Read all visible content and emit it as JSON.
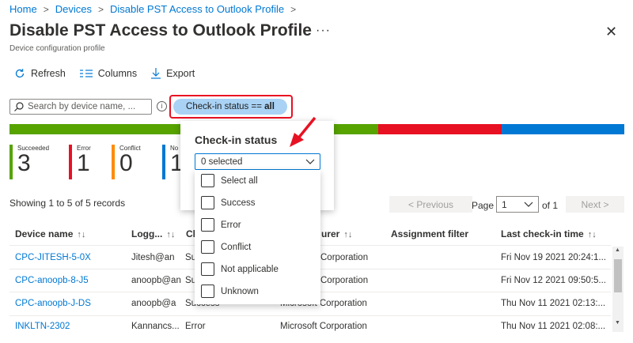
{
  "breadcrumb": [
    "Home",
    "Devices",
    "Disable PST Access to Outlook Profile"
  ],
  "title": "Disable PST Access to Outlook Profile",
  "title_menu": "···",
  "subtitle": "Device configuration profile",
  "toolbar": {
    "refresh": "Refresh",
    "columns": "Columns",
    "export": "Export"
  },
  "search": {
    "placeholder": "Search by device name, ...",
    "value": ""
  },
  "filter_pill": {
    "prefix": "Check-in status == ",
    "value": "all"
  },
  "status_bar_colors": {
    "succeeded": "#57a300",
    "error": "#e81123",
    "conflict": "#ff8c00",
    "not_applicable": "#0078d4"
  },
  "status_bar_shares": {
    "succeeded": 3,
    "error": 1,
    "conflict": 0,
    "not_applicable": 1
  },
  "counters": [
    {
      "label": "Succeeded",
      "value": "3",
      "color": "#57a300"
    },
    {
      "label": "Error",
      "value": "1",
      "color": "#e81123"
    },
    {
      "label": "Conflict",
      "value": "0",
      "color": "#ff8c00"
    },
    {
      "label": "No",
      "value": "1",
      "color": "#0078d4"
    }
  ],
  "showing_text": "Showing 1 to 5 of 5 records",
  "pager": {
    "prev": "< Previous",
    "page_label": "Page",
    "page_value": "1",
    "of_label": "of 1",
    "next": "Next >"
  },
  "table": {
    "headers": [
      "Device name",
      "Logg...",
      "Ch",
      "urer",
      "Assignment filter",
      "Last check-in time"
    ],
    "rows": [
      {
        "device": "CPC-JITESH-5-0X",
        "user": "Jitesh@an",
        "status": "Su",
        "manufacturer": "Corporation",
        "filter": "",
        "last_checkin": "Fri Nov 19 2021 20:24:1..."
      },
      {
        "device": "CPC-anoopb-8-J5",
        "user": "anoopb@an",
        "status": "Su",
        "manufacturer": "Corporation",
        "filter": "",
        "last_checkin": "Fri Nov 12 2021 09:50:5..."
      },
      {
        "device": "CPC-anoopb-J-DS",
        "user": "anoopb@a",
        "status": "Success",
        "manufacturer": "Microsoft Corporation",
        "filter": "",
        "last_checkin": "Thu Nov 11 2021 02:13:..."
      },
      {
        "device": "INKLTN-2302",
        "user": "Kannancs...",
        "status": "Error",
        "manufacturer": "Microsoft Corporation",
        "filter": "",
        "last_checkin": "Thu Nov 11 2021 02:08:..."
      }
    ]
  },
  "checkin_panel": {
    "title": "Check-in status",
    "dropdown_value": "0 selected",
    "options": [
      "Select all",
      "Success",
      "Error",
      "Conflict",
      "Not applicable",
      "Unknown"
    ]
  },
  "accent_color": "#0078d4",
  "highlight_color": "#e81123"
}
